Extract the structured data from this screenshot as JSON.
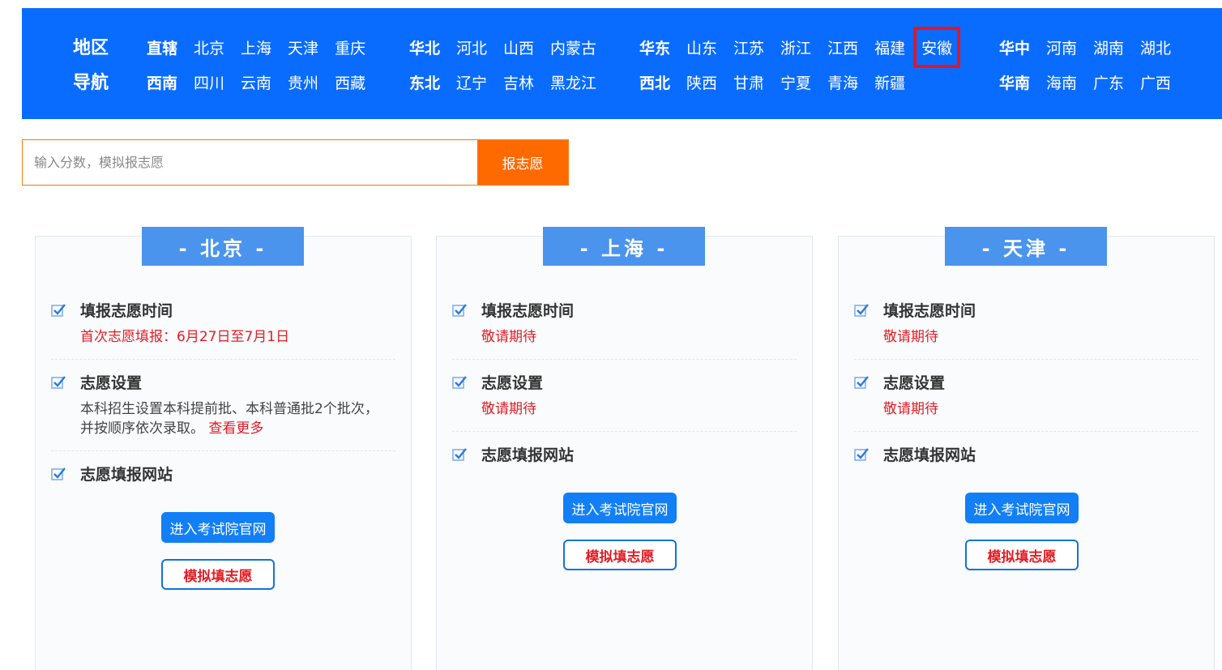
{
  "nav": {
    "title_line1": "地区",
    "title_line2": "导航",
    "groups": [
      {
        "name": "直辖",
        "provinces": [
          "北京",
          "上海",
          "天津",
          "重庆"
        ]
      },
      {
        "name": "西南",
        "provinces": [
          "四川",
          "云南",
          "贵州",
          "西藏"
        ]
      },
      {
        "name": "华北",
        "provinces": [
          "河北",
          "山西",
          "内蒙古"
        ]
      },
      {
        "name": "东北",
        "provinces": [
          "辽宁",
          "吉林",
          "黑龙江"
        ]
      },
      {
        "name": "华东",
        "provinces": [
          "山东",
          "江苏",
          "浙江",
          "江西",
          "福建",
          "安徽"
        ]
      },
      {
        "name": "西北",
        "provinces": [
          "陕西",
          "甘肃",
          "宁夏",
          "青海",
          "新疆"
        ]
      },
      {
        "name": "华中",
        "provinces": [
          "河南",
          "湖南",
          "湖北"
        ]
      },
      {
        "name": "华南",
        "provinces": [
          "海南",
          "广东",
          "广西"
        ]
      }
    ],
    "highlight_color": "#e8141e",
    "background_color": "#0a6cff"
  },
  "search": {
    "placeholder": "输入分数，模拟报志愿",
    "value": "",
    "button_label": "报志愿"
  },
  "cards": [
    {
      "title": "- 北京 -",
      "time_title": "填报志愿时间",
      "time_value": "首次志愿填报：6月27日至7月1日",
      "setting_title": "志愿设置",
      "setting_value": "本科招生设置本科提前批、本科普通批2个批次，并按顺序依次录取。",
      "setting_more": "查看更多",
      "site_title": "志愿填报网站",
      "official_button": "进入考试院官网",
      "simulate_button": "模拟填志愿"
    },
    {
      "title": "- 上海 -",
      "time_title": "填报志愿时间",
      "time_value": "敬请期待",
      "setting_title": "志愿设置",
      "setting_value": "敬请期待",
      "site_title": "志愿填报网站",
      "official_button": "进入考试院官网",
      "simulate_button": "模拟填志愿"
    },
    {
      "title": "- 天津 -",
      "time_title": "填报志愿时间",
      "time_value": "敬请期待",
      "setting_title": "志愿设置",
      "setting_value": "敬请期待",
      "site_title": "志愿填报网站",
      "official_button": "进入考试院官网",
      "simulate_button": "模拟填志愿"
    }
  ]
}
